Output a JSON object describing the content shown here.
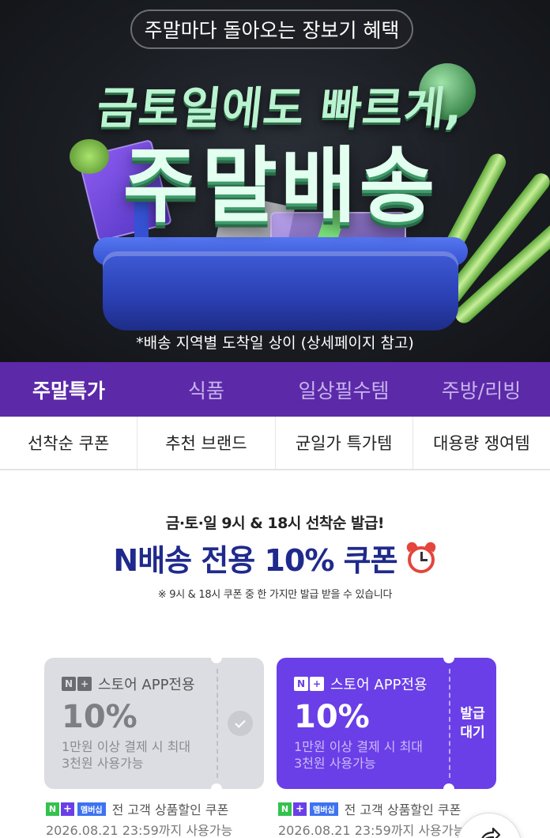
{
  "hero": {
    "pill_text": "주말마다 돌아오는 장보기 혜택",
    "headline_1": "금토일에도 빠르게,",
    "headline_2": "주말배송",
    "note": "*배송 지역별 도착일 상이 (상세페이지 참고)"
  },
  "category_tabs": [
    {
      "label": "주말특가",
      "active": true
    },
    {
      "label": "식품",
      "active": false
    },
    {
      "label": "일상필수템",
      "active": false
    },
    {
      "label": "주방/리빙",
      "active": false
    }
  ],
  "sub_tabs": [
    {
      "label": "선착순 쿠폰"
    },
    {
      "label": "추천 브랜드"
    },
    {
      "label": "균일가 특가템"
    },
    {
      "label": "대용량 쟁여템"
    }
  ],
  "promo": {
    "subtitle": "금·토·일 9시 & 18시 선착순 발급!",
    "title": "N배송 전용 10% 쿠폰",
    "note": "※ 9시 & 18시 쿠폰 중 한 가지만 발급 받을 수 있습니다"
  },
  "coupons": [
    {
      "badge_n": "N",
      "badge_plus": "+",
      "label": "스토어 APP전용",
      "percent": "10%",
      "desc_line1": "1만원 이상 결제 시 최대",
      "desc_line2": "3천원 사용가능",
      "state": "issued",
      "benefit_n": "N",
      "benefit_plus": "+",
      "benefit_badge": "멤버십",
      "benefit_text": "전 고객 상품할인 쿠폰",
      "expiry": "2026.08.21 23:59까지 사용가능"
    },
    {
      "badge_n": "N",
      "badge_plus": "+",
      "label": "스토어 APP전용",
      "percent": "10%",
      "desc_line1": "1만원 이상 결제 시 최대",
      "desc_line2": "3천원 사용가능",
      "state": "waiting",
      "status_line1": "발급",
      "status_line2": "대기",
      "benefit_n": "N",
      "benefit_plus": "+",
      "benefit_badge": "멤버십",
      "benefit_text": "전 고객 상품할인 쿠폰",
      "expiry": "2026.08.21 23:59까지 사용가능"
    }
  ],
  "colors": {
    "tab_bar": "#5c2aa8",
    "promo_title": "#1f2a8c",
    "coupon_active": "#6b3fe8",
    "coupon_inactive": "#dcdde2"
  },
  "icons": {
    "share": "share-icon",
    "check": "check-icon",
    "alarm": "alarm-clock-icon"
  }
}
